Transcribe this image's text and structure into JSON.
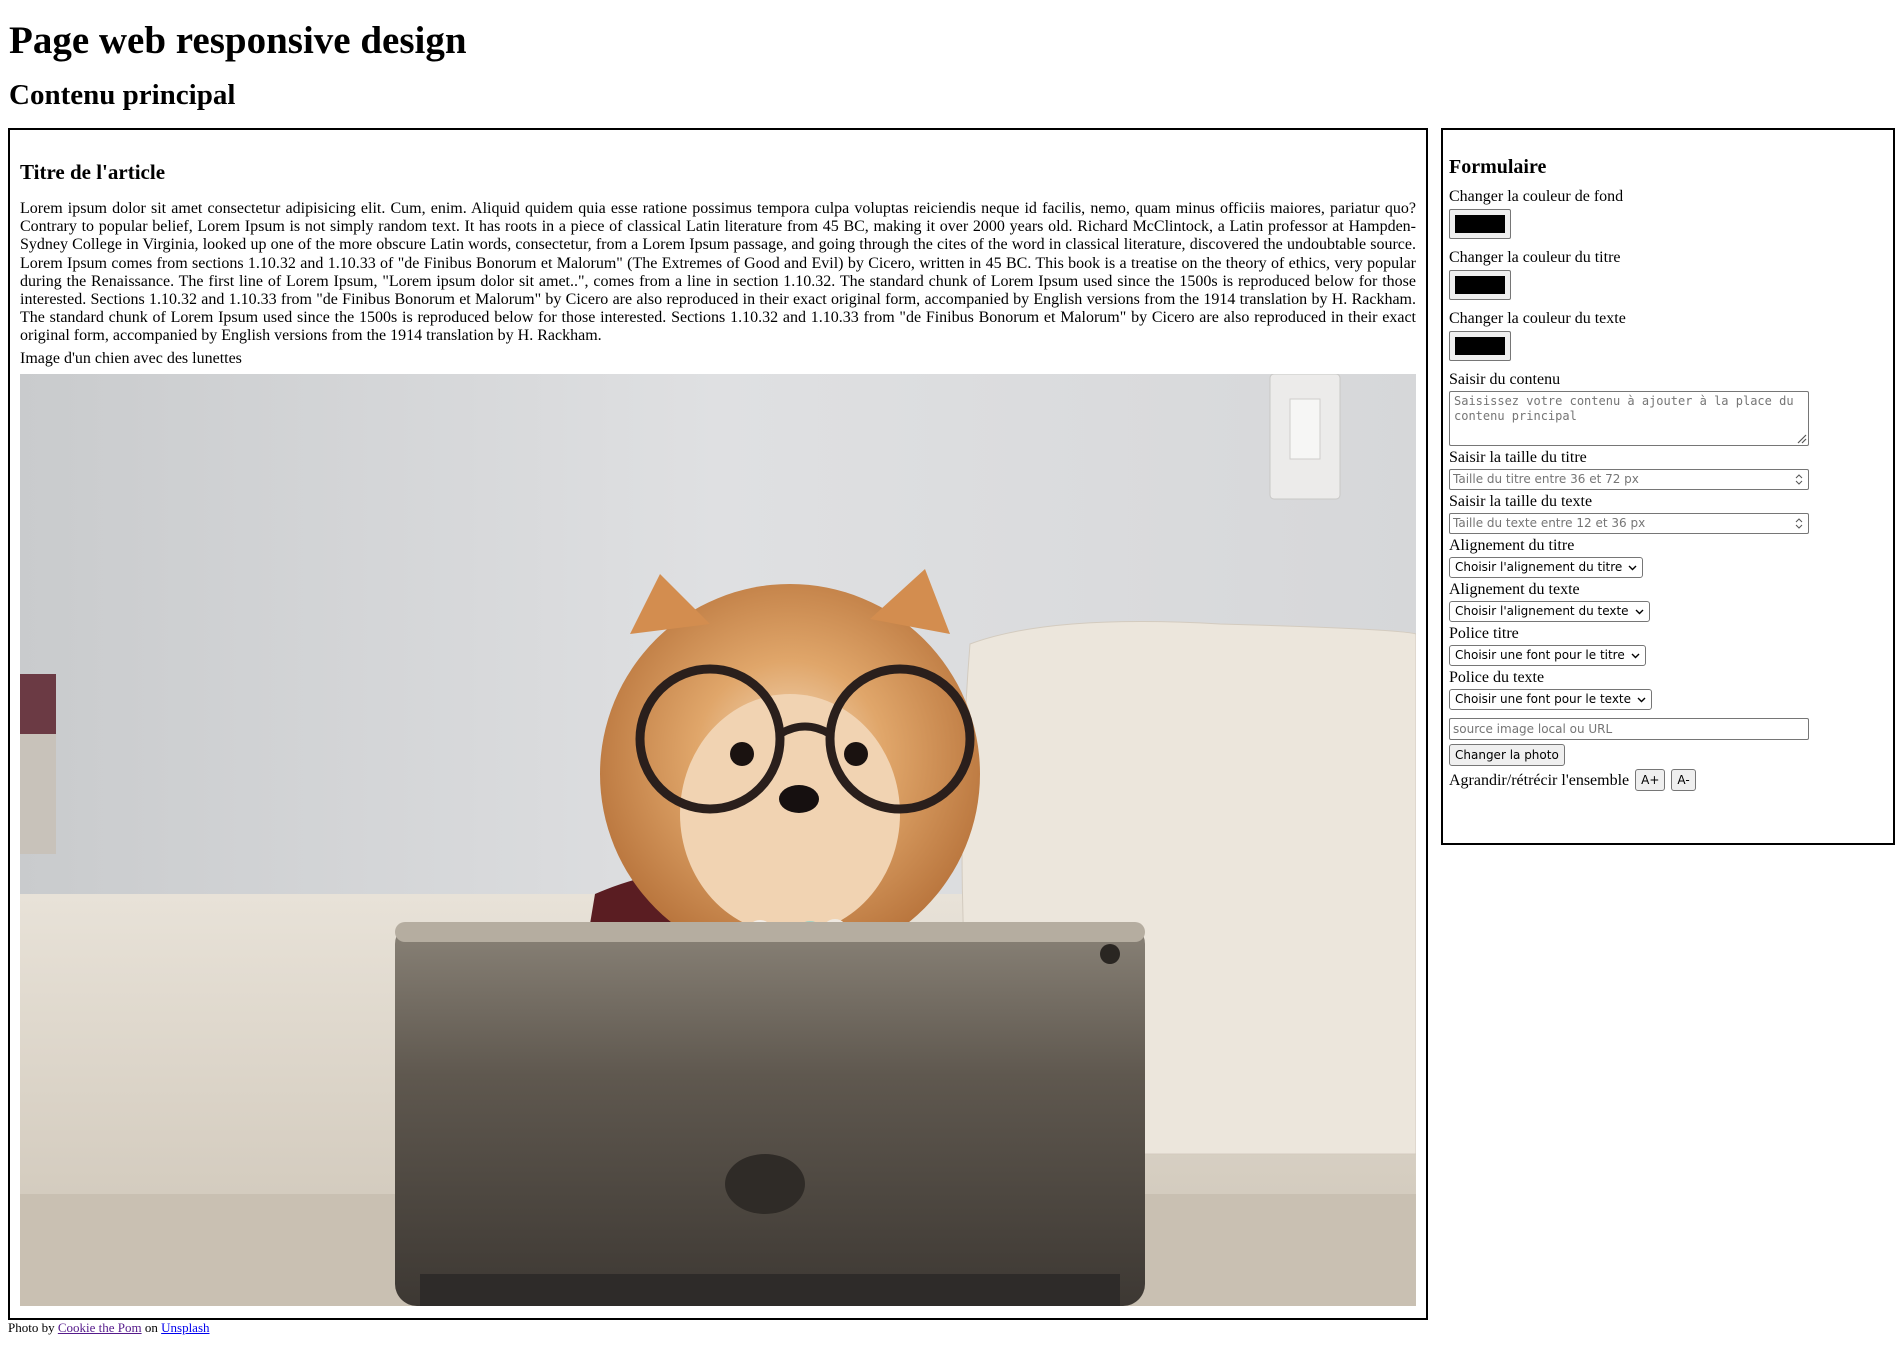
{
  "header": {
    "title": "Page web responsive design",
    "subtitle": "Contenu principal"
  },
  "article": {
    "title": "Titre de l'article",
    "text": "Lorem ipsum dolor sit amet consectetur adipisicing elit. Cum, enim. Aliquid quidem quia esse ratione possimus tempora culpa voluptas reiciendis neque id facilis, nemo, quam minus officiis maiores, pariatur quo? Contrary to popular belief, Lorem Ipsum is not simply random text. It has roots in a piece of classical Latin literature from 45 BC, making it over 2000 years old. Richard McClintock, a Latin professor at Hampden-Sydney College in Virginia, looked up one of the more obscure Latin words, consectetur, from a Lorem Ipsum passage, and going through the cites of the word in classical literature, discovered the undoubtable source. Lorem Ipsum comes from sections 1.10.32 and 1.10.33 of \"de Finibus Bonorum et Malorum\" (The Extremes of Good and Evil) by Cicero, written in 45 BC. This book is a treatise on the theory of ethics, very popular during the Renaissance. The first line of Lorem Ipsum, \"Lorem ipsum dolor sit amet..\", comes from a line in section 1.10.32. The standard chunk of Lorem Ipsum used since the 1500s is reproduced below for those interested. Sections 1.10.32 and 1.10.33 from \"de Finibus Bonorum et Malorum\" by Cicero are also reproduced in their exact original form, accompanied by English versions from the 1914 translation by H. Rackham. The standard chunk of Lorem Ipsum used since the 1500s is reproduced below for those interested. Sections 1.10.32 and 1.10.33 from \"de Finibus Bonorum et Malorum\" by Cicero are also reproduced in their exact original form, accompanied by English versions from the 1914 translation by H. Rackham.",
    "image_caption": "Image d'un chien avec des lunettes"
  },
  "form": {
    "title": "Formulaire",
    "bg_color_label": "Changer la couleur de fond",
    "bg_color_value": "#000000",
    "title_color_label": "Changer la couleur du titre",
    "title_color_value": "#000000",
    "text_color_label": "Changer la couleur du texte",
    "text_color_value": "#000000",
    "content_label": "Saisir du contenu",
    "content_placeholder": "Saisissez votre contenu à ajouter à la place du contenu principal",
    "title_size_label": "Saisir la taille du titre",
    "title_size_placeholder": "Taille du titre entre 36 et 72 px",
    "text_size_label": "Saisir la taille du texte",
    "text_size_placeholder": "Taille du texte entre 12 et 36 px",
    "title_align_label": "Alignement du titre",
    "title_align_selected": "Choisir l'alignement du titre",
    "text_align_label": "Alignement du texte",
    "text_align_selected": "Choisir l'alignement du texte",
    "title_font_label": "Police titre",
    "title_font_selected": "Choisir une font pour le titre",
    "text_font_label": "Police du texte",
    "text_font_selected": "Choisir une font pour le texte",
    "image_source_placeholder": "source image local ou URL",
    "change_photo_label": "Changer la photo",
    "zoom_label": "Agrandir/rétrécir l'ensemble",
    "zoom_in_label": "A+",
    "zoom_out_label": "A-"
  },
  "credit": {
    "prefix": "Photo by",
    "author": "Cookie the Pom",
    "middle": "on",
    "site": "Unsplash"
  },
  "icons": {
    "select_arrow": "chevron-down-icon",
    "number_spinner": "spinner-icon",
    "textarea_resize": "resize-grip-icon"
  }
}
